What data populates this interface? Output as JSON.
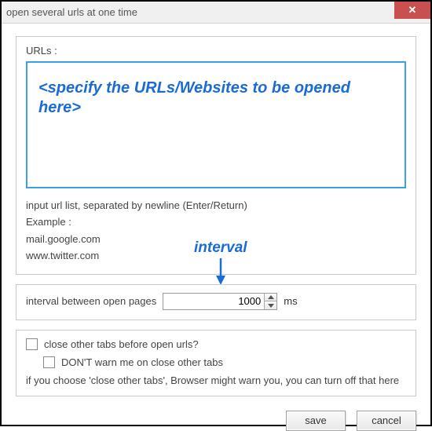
{
  "window": {
    "title": "open several urls at one time",
    "close_icon": "✕"
  },
  "urls_section": {
    "label": "URLs :",
    "textarea_value": "<specify the URLs/Websites to be opened here>",
    "hint_line1": "input url list, separated by newline (Enter/Return)",
    "hint_line2": "Example :",
    "hint_line3": "mail.google.com",
    "hint_line4": "www.twitter.com"
  },
  "annotation": {
    "text": "interval"
  },
  "interval_section": {
    "label": "interval between open pages",
    "value": "1000",
    "unit": "ms"
  },
  "tabs_section": {
    "close_other_label": "close other tabs before open urls?",
    "dont_warn_label": "DON'T warn me on close other tabs",
    "note": "if you choose 'close other tabs', Browser might warn you, you can turn off that here"
  },
  "buttons": {
    "save": "save",
    "cancel": "cancel"
  }
}
